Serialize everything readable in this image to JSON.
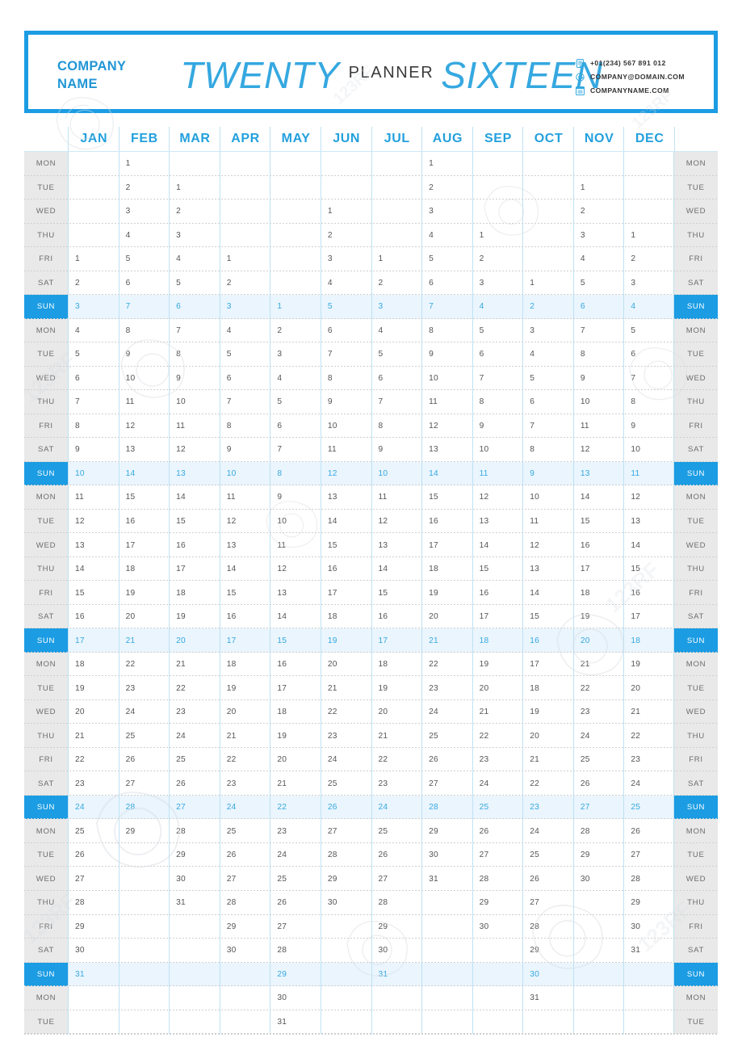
{
  "header": {
    "company_line1": "COMPANY",
    "company_line2": "NAME",
    "title_twenty": "TWENTY",
    "title_planner": "PLANNER",
    "title_sixteen": "SIXTEEN",
    "accent_color": "#1b9ce3",
    "contact": [
      {
        "icon": "phone-icon",
        "text": "+01(234) 567 891 012"
      },
      {
        "icon": "email-icon",
        "text": "COMPANY@DOMAIN.COM"
      },
      {
        "icon": "globe-icon",
        "text": "COMPANYNAME.COM"
      }
    ]
  },
  "calendar": {
    "months": [
      "JAN",
      "FEB",
      "MAR",
      "APR",
      "MAY",
      "JUN",
      "JUL",
      "AUG",
      "SEP",
      "OCT",
      "NOV",
      "DEC"
    ],
    "rows": [
      {
        "day": "MON",
        "sunday": false,
        "days": [
          "",
          "1",
          "",
          "",
          "",
          "",
          "",
          "1",
          "",
          "",
          "",
          ""
        ]
      },
      {
        "day": "TUE",
        "sunday": false,
        "days": [
          "",
          "2",
          "1",
          "",
          "",
          "",
          "",
          "2",
          "",
          "",
          "1",
          ""
        ]
      },
      {
        "day": "WED",
        "sunday": false,
        "days": [
          "",
          "3",
          "2",
          "",
          "",
          "1",
          "",
          "3",
          "",
          "",
          "2",
          ""
        ]
      },
      {
        "day": "THU",
        "sunday": false,
        "days": [
          "",
          "4",
          "3",
          "",
          "",
          "2",
          "",
          "4",
          "1",
          "",
          "3",
          "1"
        ]
      },
      {
        "day": "FRI",
        "sunday": false,
        "days": [
          "1",
          "5",
          "4",
          "1",
          "",
          "3",
          "1",
          "5",
          "2",
          "",
          "4",
          "2"
        ]
      },
      {
        "day": "SAT",
        "sunday": false,
        "days": [
          "2",
          "6",
          "5",
          "2",
          "",
          "4",
          "2",
          "6",
          "3",
          "1",
          "5",
          "3"
        ]
      },
      {
        "day": "SUN",
        "sunday": true,
        "days": [
          "3",
          "7",
          "6",
          "3",
          "1",
          "5",
          "3",
          "7",
          "4",
          "2",
          "6",
          "4"
        ]
      },
      {
        "day": "MON",
        "sunday": false,
        "days": [
          "4",
          "8",
          "7",
          "4",
          "2",
          "6",
          "4",
          "8",
          "5",
          "3",
          "7",
          "5"
        ]
      },
      {
        "day": "TUE",
        "sunday": false,
        "days": [
          "5",
          "9",
          "8",
          "5",
          "3",
          "7",
          "5",
          "9",
          "6",
          "4",
          "8",
          "6"
        ]
      },
      {
        "day": "WED",
        "sunday": false,
        "days": [
          "6",
          "10",
          "9",
          "6",
          "4",
          "8",
          "6",
          "10",
          "7",
          "5",
          "9",
          "7"
        ]
      },
      {
        "day": "THU",
        "sunday": false,
        "days": [
          "7",
          "11",
          "10",
          "7",
          "5",
          "9",
          "7",
          "11",
          "8",
          "6",
          "10",
          "8"
        ]
      },
      {
        "day": "FRI",
        "sunday": false,
        "days": [
          "8",
          "12",
          "11",
          "8",
          "6",
          "10",
          "8",
          "12",
          "9",
          "7",
          "11",
          "9"
        ]
      },
      {
        "day": "SAT",
        "sunday": false,
        "days": [
          "9",
          "13",
          "12",
          "9",
          "7",
          "11",
          "9",
          "13",
          "10",
          "8",
          "12",
          "10"
        ]
      },
      {
        "day": "SUN",
        "sunday": true,
        "days": [
          "10",
          "14",
          "13",
          "10",
          "8",
          "12",
          "10",
          "14",
          "11",
          "9",
          "13",
          "11"
        ]
      },
      {
        "day": "MON",
        "sunday": false,
        "days": [
          "11",
          "15",
          "14",
          "11",
          "9",
          "13",
          "11",
          "15",
          "12",
          "10",
          "14",
          "12"
        ]
      },
      {
        "day": "TUE",
        "sunday": false,
        "days": [
          "12",
          "16",
          "15",
          "12",
          "10",
          "14",
          "12",
          "16",
          "13",
          "11",
          "15",
          "13"
        ]
      },
      {
        "day": "WED",
        "sunday": false,
        "days": [
          "13",
          "17",
          "16",
          "13",
          "11",
          "15",
          "13",
          "17",
          "14",
          "12",
          "16",
          "14"
        ]
      },
      {
        "day": "THU",
        "sunday": false,
        "days": [
          "14",
          "18",
          "17",
          "14",
          "12",
          "16",
          "14",
          "18",
          "15",
          "13",
          "17",
          "15"
        ]
      },
      {
        "day": "FRI",
        "sunday": false,
        "days": [
          "15",
          "19",
          "18",
          "15",
          "13",
          "17",
          "15",
          "19",
          "16",
          "14",
          "18",
          "16"
        ]
      },
      {
        "day": "SAT",
        "sunday": false,
        "days": [
          "16",
          "20",
          "19",
          "16",
          "14",
          "18",
          "16",
          "20",
          "17",
          "15",
          "19",
          "17"
        ]
      },
      {
        "day": "SUN",
        "sunday": true,
        "days": [
          "17",
          "21",
          "20",
          "17",
          "15",
          "19",
          "17",
          "21",
          "18",
          "16",
          "20",
          "18"
        ]
      },
      {
        "day": "MON",
        "sunday": false,
        "days": [
          "18",
          "22",
          "21",
          "18",
          "16",
          "20",
          "18",
          "22",
          "19",
          "17",
          "21",
          "19"
        ]
      },
      {
        "day": "TUE",
        "sunday": false,
        "days": [
          "19",
          "23",
          "22",
          "19",
          "17",
          "21",
          "19",
          "23",
          "20",
          "18",
          "22",
          "20"
        ]
      },
      {
        "day": "WED",
        "sunday": false,
        "days": [
          "20",
          "24",
          "23",
          "20",
          "18",
          "22",
          "20",
          "24",
          "21",
          "19",
          "23",
          "21"
        ]
      },
      {
        "day": "THU",
        "sunday": false,
        "days": [
          "21",
          "25",
          "24",
          "21",
          "19",
          "23",
          "21",
          "25",
          "22",
          "20",
          "24",
          "22"
        ]
      },
      {
        "day": "FRI",
        "sunday": false,
        "days": [
          "22",
          "26",
          "25",
          "22",
          "20",
          "24",
          "22",
          "26",
          "23",
          "21",
          "25",
          "23"
        ]
      },
      {
        "day": "SAT",
        "sunday": false,
        "days": [
          "23",
          "27",
          "26",
          "23",
          "21",
          "25",
          "23",
          "27",
          "24",
          "22",
          "26",
          "24"
        ]
      },
      {
        "day": "SUN",
        "sunday": true,
        "days": [
          "24",
          "28",
          "27",
          "24",
          "22",
          "26",
          "24",
          "28",
          "25",
          "23",
          "27",
          "25"
        ]
      },
      {
        "day": "MON",
        "sunday": false,
        "days": [
          "25",
          "29",
          "28",
          "25",
          "23",
          "27",
          "25",
          "29",
          "26",
          "24",
          "28",
          "26"
        ]
      },
      {
        "day": "TUE",
        "sunday": false,
        "days": [
          "26",
          "",
          "29",
          "26",
          "24",
          "28",
          "26",
          "30",
          "27",
          "25",
          "29",
          "27"
        ]
      },
      {
        "day": "WED",
        "sunday": false,
        "days": [
          "27",
          "",
          "30",
          "27",
          "25",
          "29",
          "27",
          "31",
          "28",
          "26",
          "30",
          "28"
        ]
      },
      {
        "day": "THU",
        "sunday": false,
        "days": [
          "28",
          "",
          "31",
          "28",
          "26",
          "30",
          "28",
          "",
          "29",
          "27",
          "",
          "29"
        ]
      },
      {
        "day": "FRI",
        "sunday": false,
        "days": [
          "29",
          "",
          "",
          "29",
          "27",
          "",
          "29",
          "",
          "30",
          "28",
          "",
          "30"
        ]
      },
      {
        "day": "SAT",
        "sunday": false,
        "days": [
          "30",
          "",
          "",
          "30",
          "28",
          "",
          "30",
          "",
          "",
          "29",
          "",
          "31"
        ]
      },
      {
        "day": "SUN",
        "sunday": true,
        "days": [
          "31",
          "",
          "",
          "",
          "29",
          "",
          "31",
          "",
          "",
          "30",
          "",
          ""
        ]
      },
      {
        "day": "MON",
        "sunday": false,
        "days": [
          "",
          "",
          "",
          "",
          "30",
          "",
          "",
          "",
          "",
          "31",
          "",
          ""
        ]
      },
      {
        "day": "TUE",
        "sunday": false,
        "days": [
          "",
          "",
          "",
          "",
          "31",
          "",
          "",
          "",
          "",
          "",
          "",
          ""
        ]
      }
    ]
  }
}
